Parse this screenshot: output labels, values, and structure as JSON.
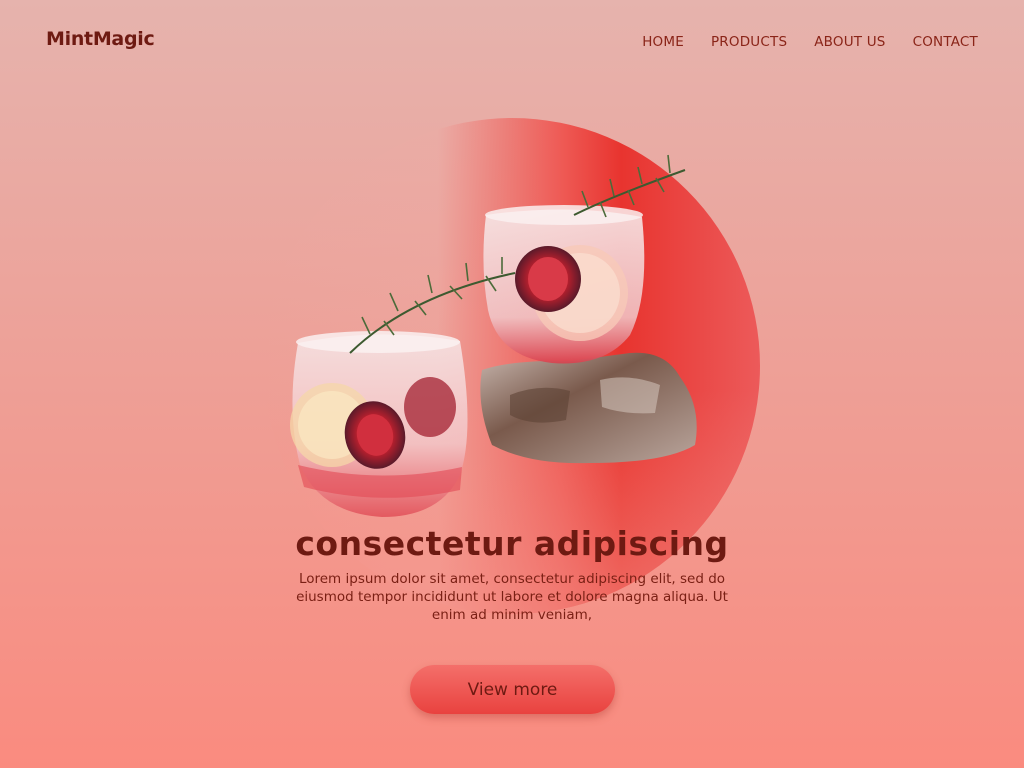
{
  "brand": {
    "logo_text": "MintMagic"
  },
  "nav": {
    "items": [
      {
        "label": "HOME"
      },
      {
        "label": "PRODUCTS"
      },
      {
        "label": "ABOUT US"
      },
      {
        "label": "CONTACT"
      }
    ]
  },
  "hero": {
    "title": "consectetur adipiscing",
    "description": "Lorem ipsum dolor sit amet, consectetur adipiscing elit, sed do eiusmod tempor incididunt ut labore et dolore magna aliqua. Ut enim ad minim veniam,",
    "cta_label": "View more",
    "image": {
      "subject": "cocktail-glasses-with-figs-and-rosemary"
    }
  },
  "colors": {
    "background_top": "#e6b3ad",
    "background_bottom": "#fa8b7f",
    "accent_circle": "#e8342f",
    "text_dark": "#6e1a12",
    "button": "#ee5a55"
  }
}
